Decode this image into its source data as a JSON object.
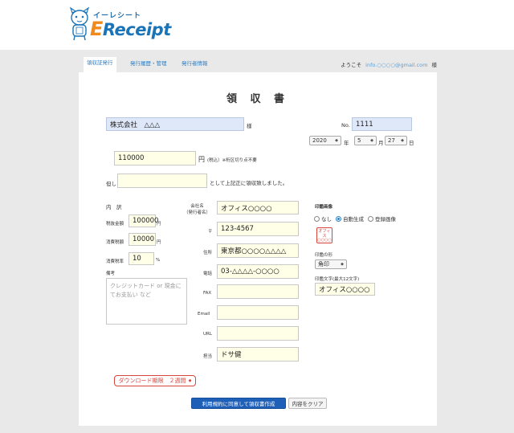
{
  "logo": {
    "kana": "イーレシート",
    "main_e": "E",
    "main_rest": "Receipt"
  },
  "nav": {
    "tabs": [
      "領収証発行",
      "発行履歴・管理",
      "発行者情報"
    ],
    "welcome_prefix": "ようこそ",
    "welcome_email": "info.○○○○@gmail.com",
    "welcome_suffix": "様"
  },
  "form": {
    "title": "領 収 書",
    "recipient": "株式会社　△△△",
    "recipient_suffix": "様",
    "no_label": "No.",
    "no_value": "1111",
    "date": {
      "year": "2020",
      "year_label": "年",
      "month": "5",
      "month_label": "月",
      "day": "27",
      "day_label": "日"
    },
    "amount": "110000",
    "amount_unit": "円",
    "amount_note": "(税込）※桁区切り点不要",
    "tadashi_label": "但し",
    "tadashi_value": "",
    "tadashi_suffix": "として上記正に領収致しました。",
    "breakdown": {
      "heading": "内　訳",
      "net_label": "税抜金額",
      "net_value": "100000",
      "net_unit": "円",
      "tax_label": "消費税額",
      "tax_value": "10000",
      "tax_unit": "円",
      "rate_label": "消費税率",
      "rate_value": "10",
      "rate_unit": "%"
    },
    "memo_label": "備考",
    "memo_placeholder": "クレジットカード or 現金にてお支払い など",
    "issuer": {
      "company_label": "会社名\n（発行者名）",
      "company_label_1": "会社名",
      "company_label_2": "（発行者名）",
      "company_value": "オフィス○○○○",
      "zip_label": "〒",
      "zip_value": "123-4567",
      "address_label": "住所",
      "address_value": "東京都○○○○△△△△",
      "tel_label": "電話",
      "tel_value": "03-△△△△-○○○○",
      "fax_label": "FAX",
      "fax_value": "",
      "email_label": "Email",
      "email_value": "",
      "url_label": "URL",
      "url_value": "",
      "person_label": "担当",
      "person_value": "ドサ健"
    },
    "seal": {
      "heading": "印鑑画像",
      "options": [
        "なし",
        "自動生成",
        "登録画像"
      ],
      "selected_index": 1,
      "stamp_text": "オフィス○○○○",
      "shape_label": "印鑑の形",
      "shape_value": "角印",
      "text_label": "印鑑文字(最大12文字)",
      "text_value": "オフィス○○○○"
    },
    "expire": "ダウンロード期限　２週間",
    "submit": "利用規約に同意して領収書作成",
    "clear": "内容をクリア"
  },
  "colors": {
    "brand_blue": "#1b74b8",
    "brand_orange": "#f08a1c",
    "stamp_red": "#d8453b",
    "primary_button": "#1e5fb8"
  },
  "icons": [
    "mascot-icon",
    "chevron-down-icon",
    "radio-icon"
  ]
}
